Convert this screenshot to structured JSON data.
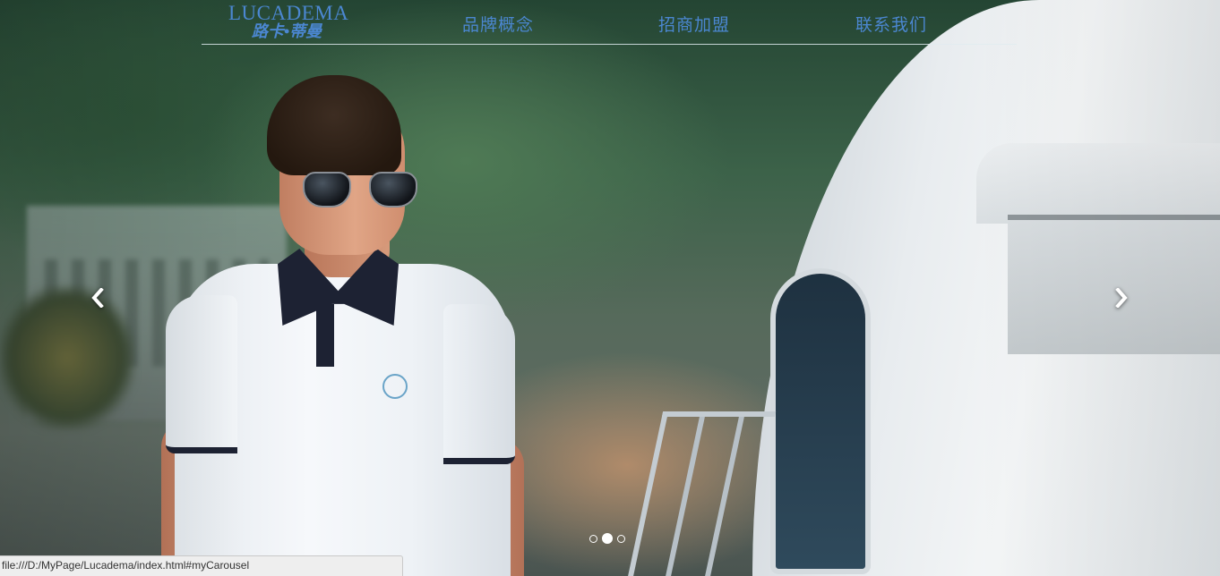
{
  "brand": {
    "name_en": "LUCADEMA",
    "name_cn": "路卡•蒂曼"
  },
  "nav": {
    "items": [
      {
        "label": "品牌概念"
      },
      {
        "label": "招商加盟"
      },
      {
        "label": "联系我们"
      }
    ]
  },
  "carousel": {
    "prev_icon": "chevron-left-icon",
    "next_icon": "chevron-right-icon",
    "slide_count": 3,
    "active_index": 1
  },
  "status_bar": {
    "url": "file:///D:/MyPage/Lucadema/index.html#myCarousel"
  },
  "colors": {
    "brand_blue": "#4b87d1",
    "nav_rule": "#e1ebf0",
    "status_bg": "#eeeeee"
  }
}
